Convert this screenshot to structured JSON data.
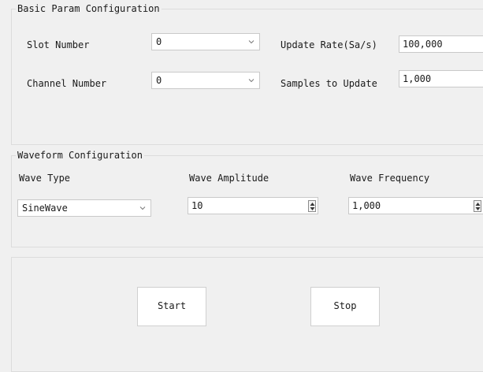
{
  "basic": {
    "title": "Basic Param Configuration",
    "slot_label": "Slot Number",
    "slot_value": "0",
    "channel_label": "Channel Number",
    "channel_value": "0",
    "rate_label": "Update Rate(Sa/s)",
    "rate_value": "100,000",
    "samples_label": "Samples to Update",
    "samples_value": "1,000"
  },
  "waveform": {
    "title": "Waveform Configuration",
    "type_label": "Wave Type",
    "type_value": "SineWave",
    "amp_label": "Wave Amplitude",
    "amp_value": "10",
    "freq_label": "Wave Frequency",
    "freq_value": "1,000"
  },
  "controls": {
    "start_label": "Start",
    "stop_label": "Stop"
  },
  "icons": {
    "dropdown": "chevron-down-icon",
    "spin": "spin-up-down-icon"
  }
}
